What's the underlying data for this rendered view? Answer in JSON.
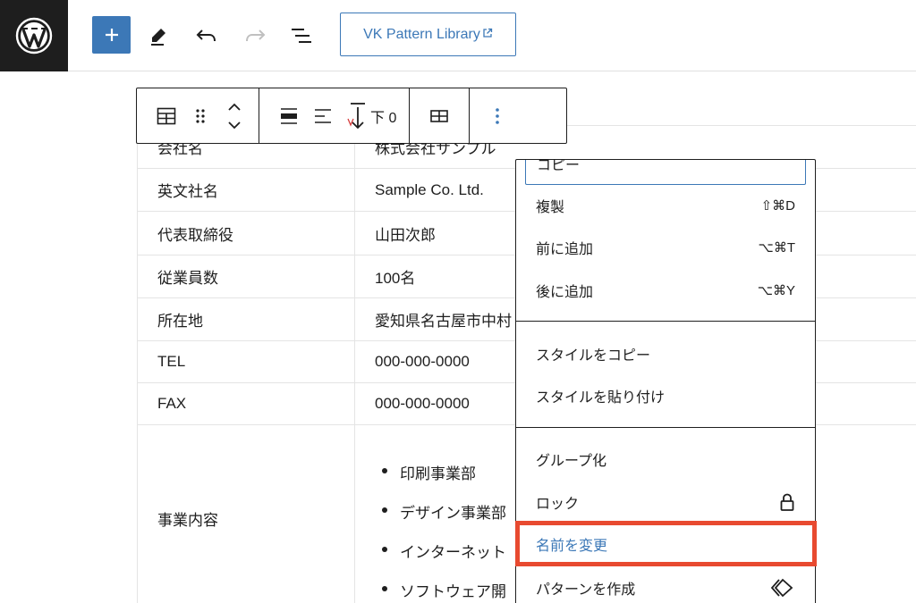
{
  "topbar": {
    "vk_button": "VK Pattern Library"
  },
  "icons": {
    "logo": "wordpress-logo-icon",
    "add": "plus-icon",
    "edit": "pencil-icon",
    "undo": "undo-icon",
    "redo": "redo-icon",
    "list": "list-view-icon",
    "external": "external-link-icon"
  },
  "block_toolbar": {
    "bottom_label": "下 0"
  },
  "table": {
    "rows": [
      {
        "label": "会社名",
        "value": "株式会社サンプル"
      },
      {
        "label": "英文社名",
        "value": "Sample Co. Ltd."
      },
      {
        "label": "代表取締役",
        "value": "山田次郎"
      },
      {
        "label": "従業員数",
        "value": "100名"
      },
      {
        "label": "所在地",
        "value": "愛知県名古屋市中村"
      },
      {
        "label": "TEL",
        "value": "000-000-0000"
      },
      {
        "label": "FAX",
        "value": "000-000-0000"
      }
    ],
    "business": {
      "label": "事業内容",
      "items": [
        "印刷事業部",
        "デザイン事業部",
        "インターネット",
        "ソフトウェア開"
      ]
    }
  },
  "menu": {
    "copy": "コピー",
    "duplicate": {
      "label": "複製",
      "shortcut": "⇧⌘D"
    },
    "insert_before": {
      "label": "前に追加",
      "shortcut": "⌥⌘T"
    },
    "insert_after": {
      "label": "後に追加",
      "shortcut": "⌥⌘Y"
    },
    "copy_styles": "スタイルをコピー",
    "paste_styles": "スタイルを貼り付け",
    "group": "グループ化",
    "lock": "ロック",
    "rename": "名前を変更",
    "create_pattern": "パターンを作成"
  },
  "colors": {
    "accent": "#3c78b7",
    "highlight": "#e84a30",
    "dark": "#1e1e1e"
  }
}
